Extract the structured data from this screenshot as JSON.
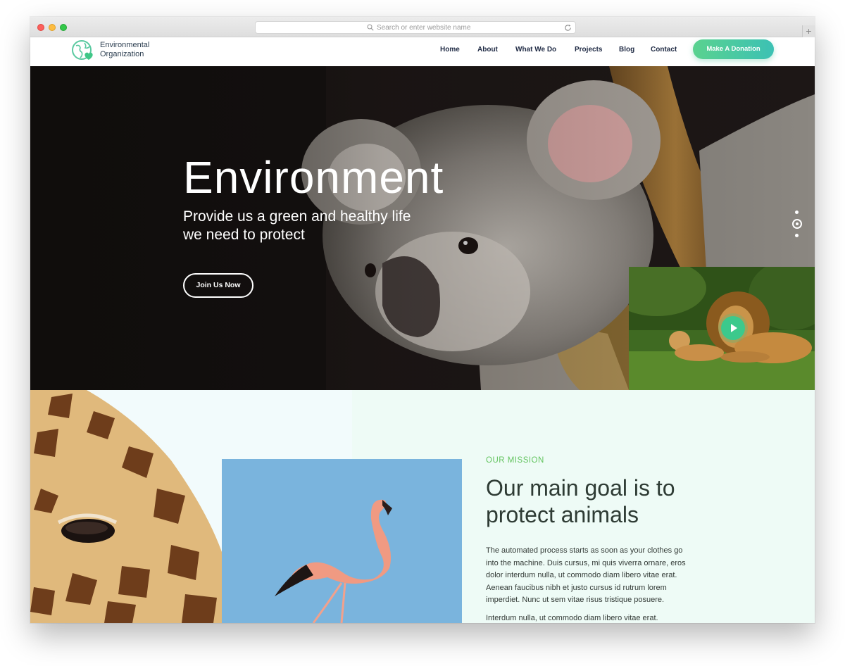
{
  "browser": {
    "url_placeholder": "Search or enter website name",
    "new_tab_label": "+"
  },
  "header": {
    "logo_line1": "Environmental",
    "logo_line2": "Organization",
    "nav": [
      "Home",
      "About",
      "What We Do",
      "Projects",
      "Blog",
      "Contact"
    ],
    "donate_label": "Make A Donation"
  },
  "hero": {
    "title": "Environment",
    "subtitle_line1": "Provide us a green and healthy life",
    "subtitle_line2": "we need to protect",
    "cta_label": "Join Us Now",
    "slider_total": 3,
    "slider_active": 2
  },
  "mission": {
    "label": "OUR MISSION",
    "title_line1": "Our main goal is to",
    "title_line2": "protect animals",
    "body_lines": [
      "The automated process starts as soon as your clothes go",
      "into the machine. Duis cursus, mi quis viverra ornare, eros",
      "dolor interdum nulla, ut commodo diam libero vitae erat.",
      "Aenean faucibus nibh et justo cursus id rutrum lorem",
      "imperdiet. Nunc ut sem vitae risus tristique posuere."
    ],
    "body2": "Interdum nulla, ut commodo diam libero vitae erat."
  },
  "colors": {
    "accent_green": "#5ad28f",
    "accent_teal": "#3cc1b4",
    "label_green": "#63c45f",
    "nav_text": "#1f2a44",
    "mission_bg": "#eefbf6"
  },
  "icons": [
    "logo-globe-heart-icon",
    "search-icon",
    "reload-icon",
    "play-icon"
  ]
}
